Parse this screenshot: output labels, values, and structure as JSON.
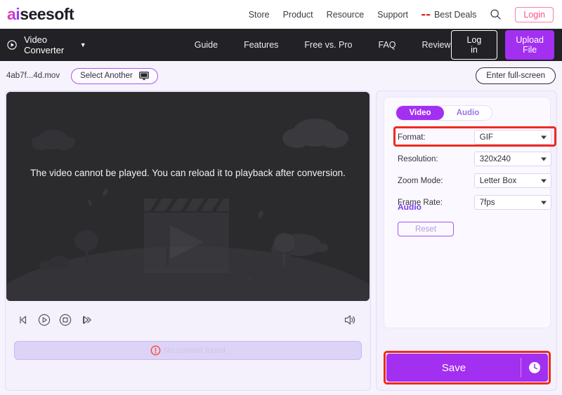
{
  "header": {
    "logo_ai": "ai",
    "logo_rest": "seesoft",
    "nav": [
      {
        "label": "Store"
      },
      {
        "label": "Product"
      },
      {
        "label": "Resource"
      },
      {
        "label": "Support"
      }
    ],
    "best_deals": "Best Deals",
    "search_icon": "search-icon",
    "login_label": "Login"
  },
  "darknav": {
    "brand_icon": "play-circle-icon",
    "brand": "Video Converter",
    "caret": "▼",
    "links": [
      {
        "label": "Guide"
      },
      {
        "label": "Features"
      },
      {
        "label": "Free vs. Pro"
      },
      {
        "label": "FAQ"
      },
      {
        "label": "Review"
      }
    ],
    "login_label": "Log in",
    "upload_label": "Upload File"
  },
  "subbar": {
    "filename": "4ab7f...4d.mov",
    "select_another": "Select Another",
    "monitor_icon": "monitor-icon",
    "fullscreen": "Enter full-screen"
  },
  "player": {
    "message": "The video cannot be played. You can reload it to playback after conversion.",
    "controls": [
      {
        "name": "previous-icon"
      },
      {
        "name": "play-icon"
      },
      {
        "name": "stop-icon"
      },
      {
        "name": "forward-icon"
      }
    ],
    "volume_icon": "volume-icon",
    "no_content": "No content found",
    "warning_icon": "warning-icon"
  },
  "settings": {
    "tabs": [
      {
        "label": "Video",
        "active": true
      },
      {
        "label": "Audio",
        "active": false
      }
    ],
    "rows": [
      {
        "label": "Format:",
        "value": "GIF"
      },
      {
        "label": "Resolution:",
        "value": "320x240"
      },
      {
        "label": "Zoom Mode:",
        "value": "Letter Box"
      },
      {
        "label": "Frame Rate:",
        "value": "7fps"
      }
    ],
    "audio_section": "Audio",
    "reset_label": "Reset",
    "save_label": "Save",
    "clock_icon": "clock-icon"
  },
  "colors": {
    "accent_purple": "#a32ff0",
    "highlight_red": "#ee2b1f",
    "panel_bg": "#f4f0fc",
    "dark_nav": "#212126",
    "video_bg": "#2b2b2e"
  }
}
